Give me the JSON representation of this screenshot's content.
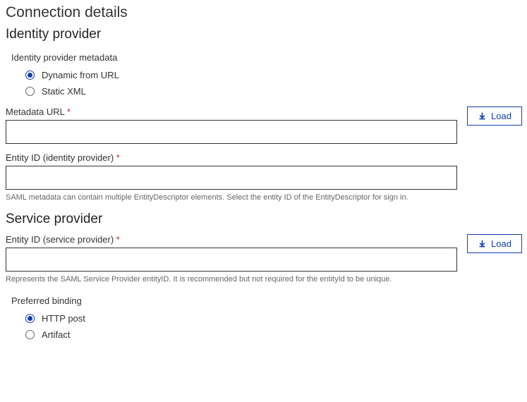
{
  "page_title": "Connection details",
  "identity_provider": {
    "title": "Identity provider",
    "metadata_group_label": "Identity provider metadata",
    "metadata_options": [
      {
        "label": "Dynamic from URL",
        "selected": true
      },
      {
        "label": "Static XML",
        "selected": false
      }
    ],
    "metadata_url": {
      "label": "Metadata URL",
      "required_mark": "*",
      "value": "",
      "load_button": "Load"
    },
    "entity_id": {
      "label": "Entity ID (identity provider)",
      "required_mark": "*",
      "value": "",
      "help": "SAML metadata can contain multiple EntityDescriptor elements. Select the entity ID of the EntityDescriptor for sign in."
    }
  },
  "service_provider": {
    "title": "Service provider",
    "entity_id": {
      "label": "Entity ID (service provider)",
      "required_mark": "*",
      "value": "",
      "help": "Represents the SAML Service Provider entityID. It is recommended but not required for the entityId to be unique.",
      "load_button": "Load"
    },
    "preferred_binding": {
      "label": "Preferred binding",
      "options": [
        {
          "label": "HTTP post",
          "selected": true
        },
        {
          "label": "Artifact",
          "selected": false
        }
      ]
    }
  }
}
